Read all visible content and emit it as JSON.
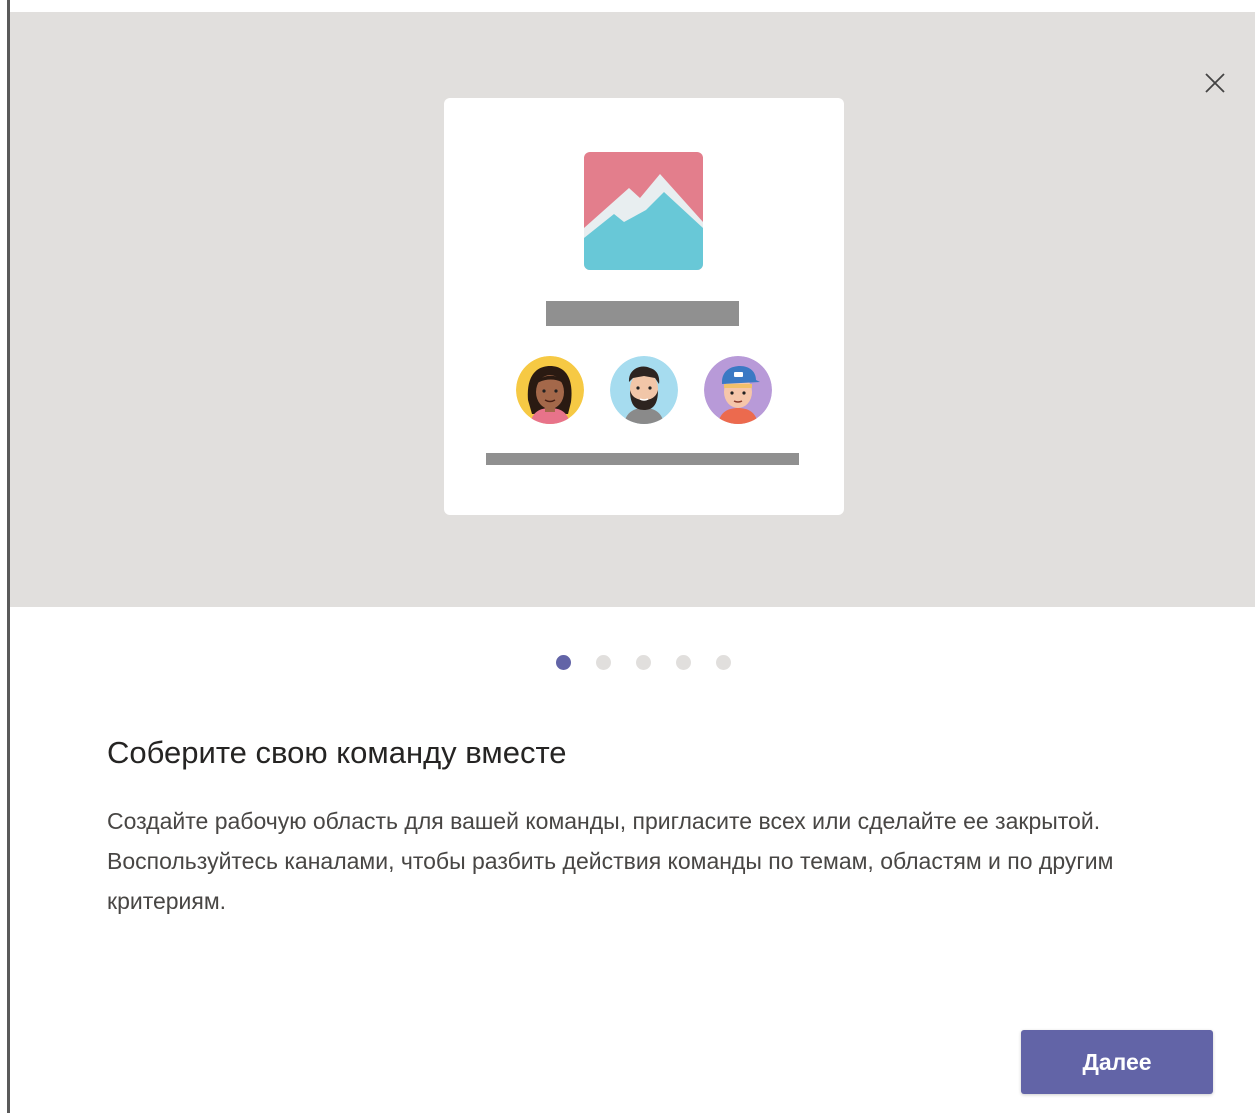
{
  "dialog": {
    "close_icon": "close-icon",
    "carousel": {
      "total_slides": 5,
      "active_index": 0,
      "active_color": "#6264a7",
      "inactive_color": "#e1dfdd"
    },
    "title": "Соберите свою команду вместе",
    "description": "Создайте рабочую область для вашей команды, пригласите всех или сделайте ее закрытой. Воспользуйтесь каналами, чтобы разбить действия команды по темам, областям и по другим критериям.",
    "next_button_label": "Далее",
    "colors": {
      "accent": "#6264a7",
      "hero_background": "#e1dfdd"
    }
  }
}
